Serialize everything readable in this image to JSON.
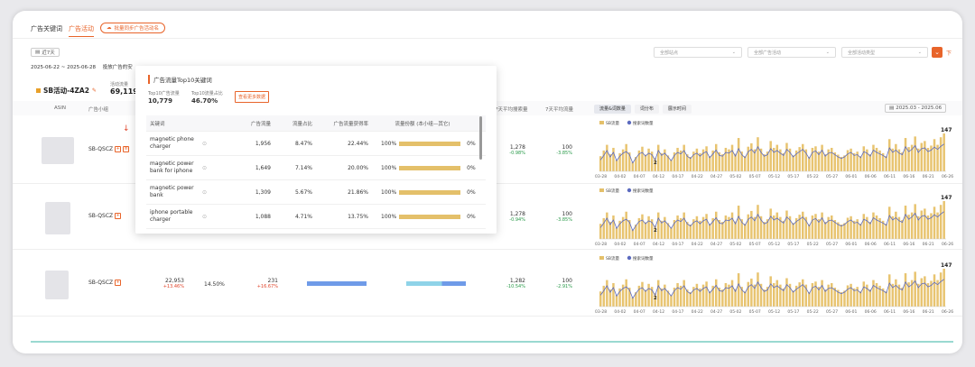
{
  "tabs": [
    {
      "label": "广告关键词"
    },
    {
      "label": "广告活动"
    }
  ],
  "sync_button": "批量同步广告活动名",
  "date_filter": "近7天",
  "date_range": "2025-06-22 ~ 2025-06-28",
  "date_range_suffix": "投放广告的安",
  "selects": [
    "全部站点",
    "全部广告活动",
    "全部活动类型"
  ],
  "export_label": "下",
  "summary": {
    "name": "SB活动-4ZA2",
    "metric_label": "活动流量",
    "metric_value": "69,119"
  },
  "table_headers": {
    "asin": "ASIN",
    "group": "广告小组",
    "avg_search": "7天平均搜索量",
    "avg_flow": "7天平均流量"
  },
  "rows": [
    {
      "group": "SB-QSCZ",
      "avg_search": "1,278",
      "avg_search_change": "-0.98%",
      "avg_flow": "100",
      "avg_flow_change": "-3.85%"
    },
    {
      "group": "SB-QSCZ",
      "avg_search": "1,278",
      "avg_search_change": "-0.94%",
      "avg_flow": "100",
      "avg_flow_change": "-3.85%"
    },
    {
      "group": "SB-QSCZ",
      "traffic": "22,953",
      "traffic_change": "+13.46%",
      "share": "14.50%",
      "clicks": "231",
      "clicks_change": "+16.67%",
      "avg_search": "1,282",
      "avg_search_change": "-10.54%",
      "avg_flow": "100",
      "avg_flow_change": "-2.91%"
    }
  ],
  "chart_tabs": [
    "流量&词数量",
    "词分布",
    "展示时间"
  ],
  "chart_date": "2025.03 - 2025.06",
  "legend": {
    "bar": "SB流量",
    "line": "搜索词数量"
  },
  "popup": {
    "title": "广告流量Top10关键词",
    "stat1_label": "Top10广告流量",
    "stat1_value": "10,779",
    "stat2_label": "Top10流量占比",
    "stat2_value": "46.70%",
    "more_button": "查看更多数据",
    "headers": [
      "关键词",
      "广告流量",
      "流量占比",
      "广告流量获得率",
      "流量份额 (本小组—其它)"
    ],
    "rows": [
      {
        "keyword": "magnetic phone charger",
        "traffic": "1,956",
        "share": "8.47%",
        "rate": "22.44%",
        "left": "100%",
        "right": "0%",
        "fill": 1.0
      },
      {
        "keyword": "magnetic power bank for iphone",
        "traffic": "1,649",
        "share": "7.14%",
        "rate": "20.00%",
        "left": "100%",
        "right": "0%",
        "fill": 1.0
      },
      {
        "keyword": "magnetic power bank",
        "traffic": "1,309",
        "share": "5.67%",
        "rate": "21.86%",
        "left": "100%",
        "right": "0%",
        "fill": 1.0
      },
      {
        "keyword": "iphone portable charger",
        "traffic": "1,088",
        "share": "4.71%",
        "rate": "13.75%",
        "left": "100%",
        "right": "0%",
        "fill": 1.0
      }
    ]
  },
  "chart_data": {
    "type": "bar",
    "x_ticks": [
      "03-28",
      "04-02",
      "04-07",
      "04-12",
      "04-17",
      "04-22",
      "04-27",
      "05-02",
      "05-07",
      "05-12",
      "05-17",
      "05-22",
      "05-27",
      "06-01",
      "06-06",
      "06-11",
      "06-16",
      "06-21",
      "06-26"
    ],
    "annotations": {
      "min": "2",
      "max": "147"
    },
    "series": [
      {
        "name": "SB流量"
      },
      {
        "name": "搜索词数量"
      }
    ],
    "bar_values": [
      40,
      55,
      70,
      45,
      62,
      30,
      48,
      58,
      72,
      50,
      25,
      38,
      55,
      65,
      44,
      60,
      52,
      35,
      70,
      48,
      58,
      42,
      30,
      50,
      62,
      55,
      70,
      45,
      38,
      52,
      60,
      48,
      58,
      66,
      40,
      55,
      72,
      50,
      45,
      62,
      58,
      70,
      46,
      88,
      52,
      40,
      65,
      74,
      58,
      90,
      60,
      45,
      52,
      80,
      62,
      70,
      58,
      48,
      75,
      60,
      42,
      55,
      64,
      72,
      58,
      38,
      62,
      66,
      52,
      70,
      45,
      58,
      62,
      50,
      44,
      38,
      42,
      56,
      60,
      48,
      52,
      40,
      66,
      58,
      45,
      70,
      62,
      55,
      48,
      40,
      85,
      60,
      72,
      58,
      50,
      88,
      64,
      70,
      92,
      60,
      75,
      80,
      62,
      68,
      85,
      70,
      90,
      100
    ],
    "line_values": [
      30,
      42,
      55,
      38,
      50,
      28,
      40,
      48,
      52,
      44,
      22,
      35,
      46,
      50,
      40,
      48,
      44,
      30,
      55,
      42,
      48,
      38,
      28,
      42,
      50,
      46,
      55,
      40,
      34,
      44,
      48,
      40,
      48,
      52,
      36,
      46,
      56,
      42,
      40,
      50,
      48,
      55,
      40,
      60,
      44,
      36,
      52,
      58,
      48,
      65,
      50,
      40,
      44,
      60,
      50,
      55,
      48,
      42,
      58,
      50,
      38,
      46,
      52,
      58,
      48,
      34,
      50,
      54,
      44,
      56,
      40,
      48,
      50,
      44,
      38,
      34,
      38,
      46,
      50,
      42,
      44,
      36,
      52,
      48,
      40,
      56,
      50,
      46,
      42,
      36,
      62,
      50,
      56,
      48,
      44,
      65,
      52,
      58,
      68,
      50,
      60,
      62,
      52,
      56,
      64,
      58,
      66,
      72
    ]
  }
}
